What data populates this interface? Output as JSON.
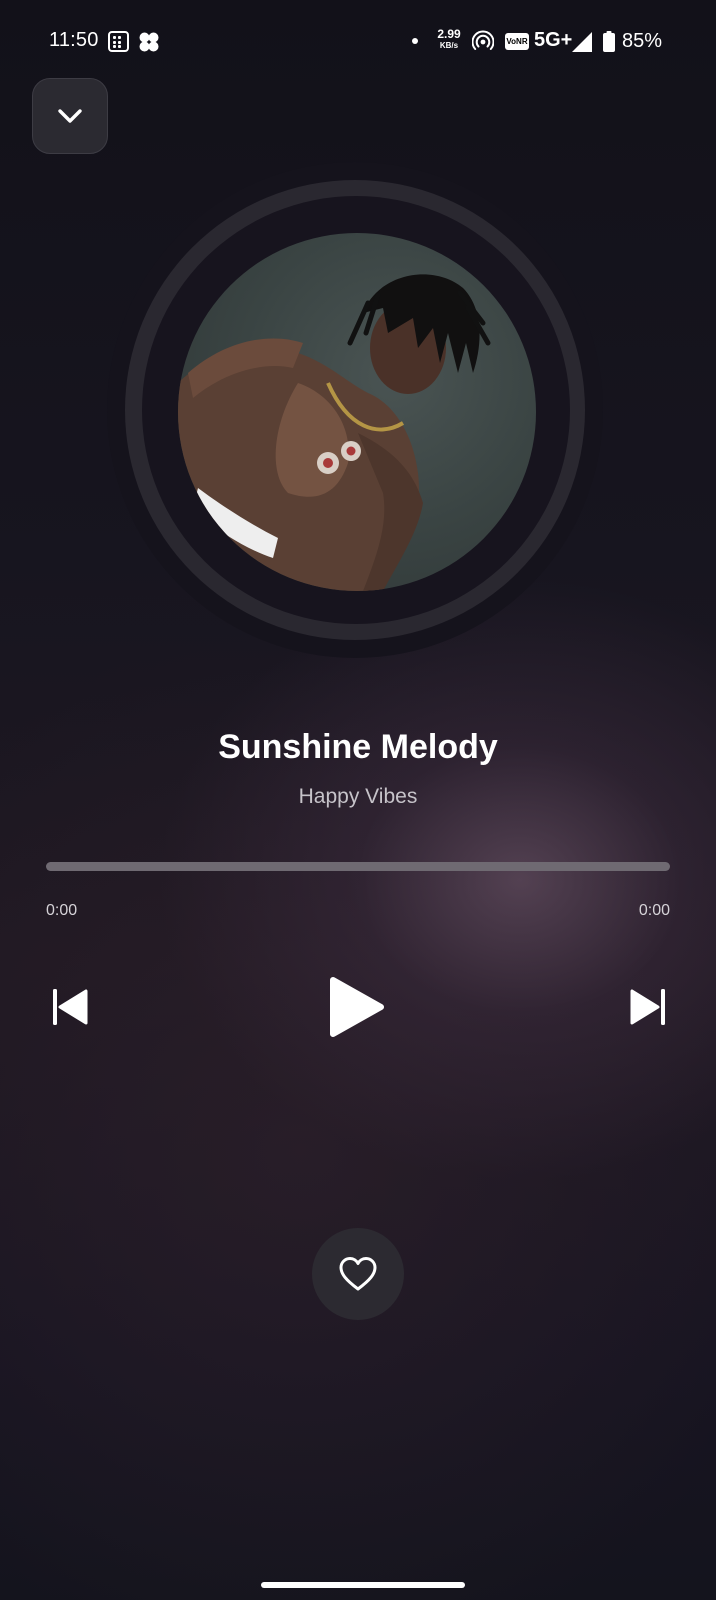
{
  "status_bar": {
    "time": "11:50",
    "speed_value": "2.99",
    "speed_unit": "KB/s",
    "vonr": "VoNR",
    "network": "5G+",
    "battery": "85%"
  },
  "icons": {
    "collapse": "chevron-down-icon",
    "previous": "skip-previous-icon",
    "play": "play-icon",
    "next": "skip-next-icon",
    "favorite": "heart-outline-icon"
  },
  "song": {
    "title": "Sunshine Melody",
    "artist": "Happy Vibes"
  },
  "playback": {
    "elapsed": "0:00",
    "duration": "0:00",
    "progress": 0
  },
  "colors": {
    "accent": "#ffffff",
    "track": "#6f6a72",
    "button_bg": "#2c2a31"
  }
}
